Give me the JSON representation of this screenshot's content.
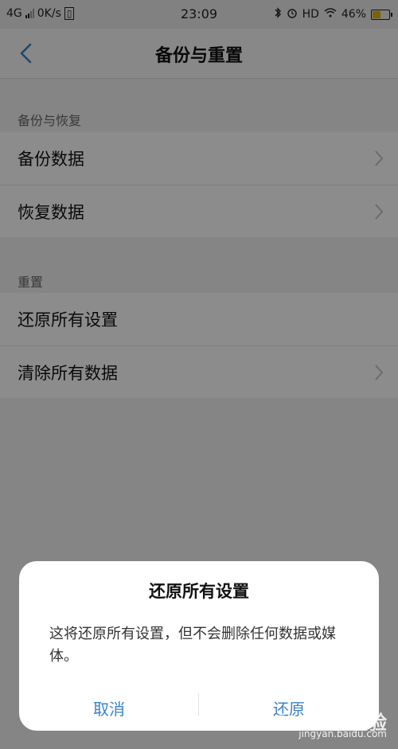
{
  "status_bar": {
    "network": "4G",
    "speed": "0K/s",
    "time": "23:09",
    "hd": "HD",
    "battery_percent": "46%",
    "battery_level": 0.46
  },
  "header": {
    "title": "备份与重置"
  },
  "sections": [
    {
      "label": "备份与恢复",
      "items": [
        {
          "label": "备份数据",
          "has_chevron": true
        },
        {
          "label": "恢复数据",
          "has_chevron": true
        }
      ]
    },
    {
      "label": "重置",
      "items": [
        {
          "label": "还原所有设置",
          "has_chevron": false
        },
        {
          "label": "清除所有数据",
          "has_chevron": true
        }
      ]
    }
  ],
  "dialog": {
    "title": "还原所有设置",
    "message": "这将还原所有设置，但不会删除任何数据或媒体。",
    "cancel_label": "取消",
    "confirm_label": "还原"
  },
  "watermark": {
    "brand": "Bai du 经验",
    "url": "jingyan.baidu.com"
  },
  "colors": {
    "accent": "#3b82c4",
    "overlay": "rgba(0,0,0,0.45)"
  },
  "icons": {
    "back": "chevron-left-icon",
    "row_arrow": "chevron-right-icon",
    "bluetooth": "bluetooth-icon",
    "alarm": "alarm-icon",
    "wifi": "wifi-icon",
    "battery": "battery-icon"
  }
}
